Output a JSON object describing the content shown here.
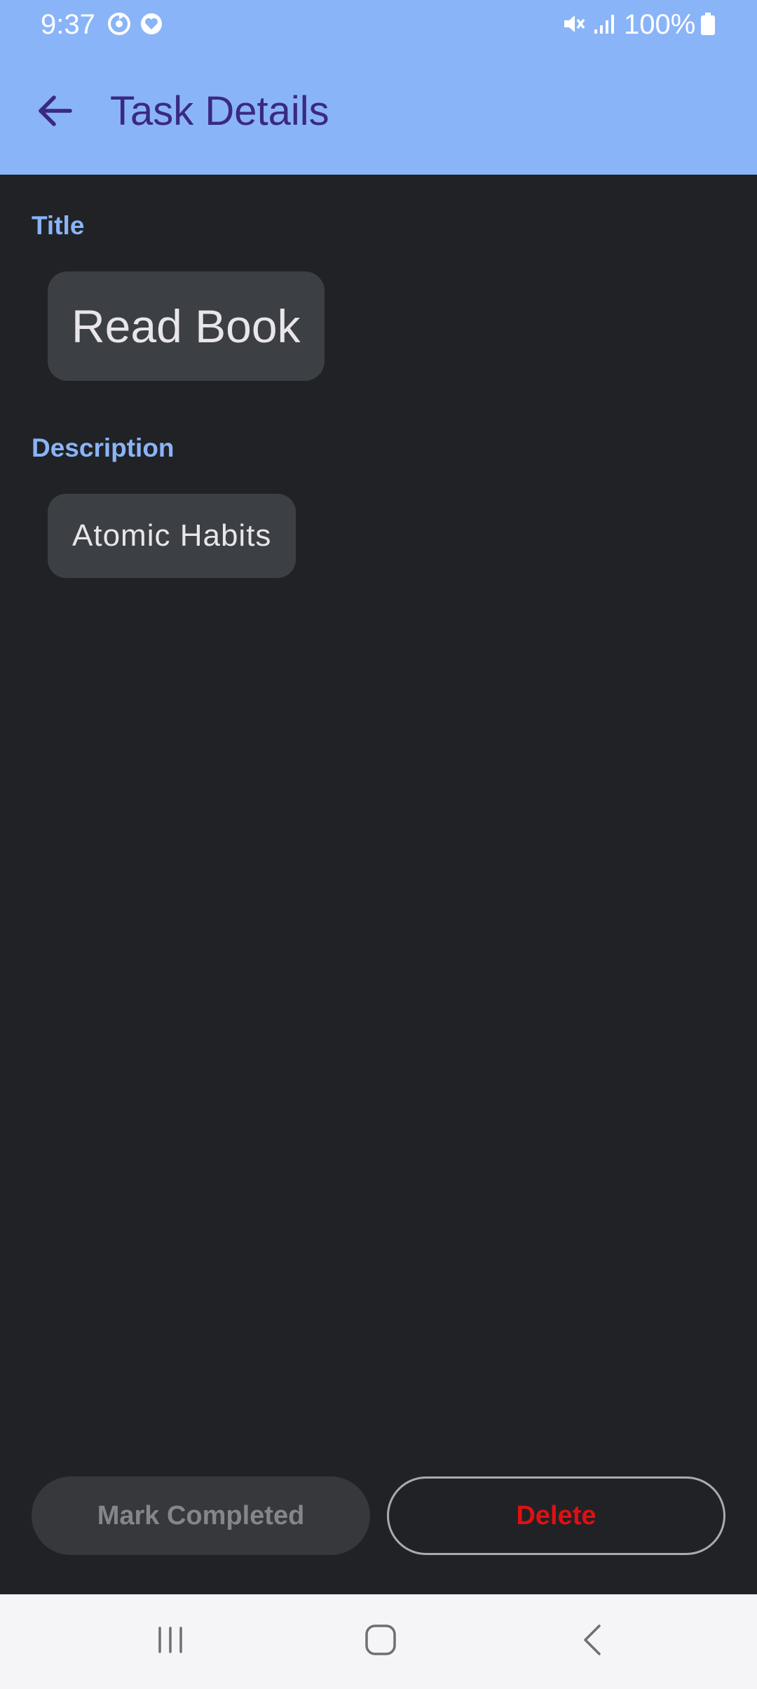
{
  "status_bar": {
    "time": "9:37",
    "battery": "100%",
    "icons": [
      "sync-icon",
      "heart-badge-icon",
      "mute-icon",
      "signal-icon",
      "battery-icon"
    ]
  },
  "app_bar": {
    "title": "Task Details",
    "back_icon": "arrow-left-icon"
  },
  "fields": {
    "title_label": "Title",
    "title_value": "Read Book",
    "description_label": "Description",
    "description_value": "Atomic Habits"
  },
  "actions": {
    "mark_completed": "Mark Completed",
    "delete": "Delete"
  },
  "nav_bar": {
    "icons": [
      "recent-apps-icon",
      "home-icon",
      "back-icon"
    ]
  },
  "colors": {
    "header": "#8AB4F8",
    "background": "#212226",
    "title_text": "#3A2A7E",
    "label": "#8AB4F8",
    "chip": "#3C3F43",
    "delete": "#E01010"
  }
}
